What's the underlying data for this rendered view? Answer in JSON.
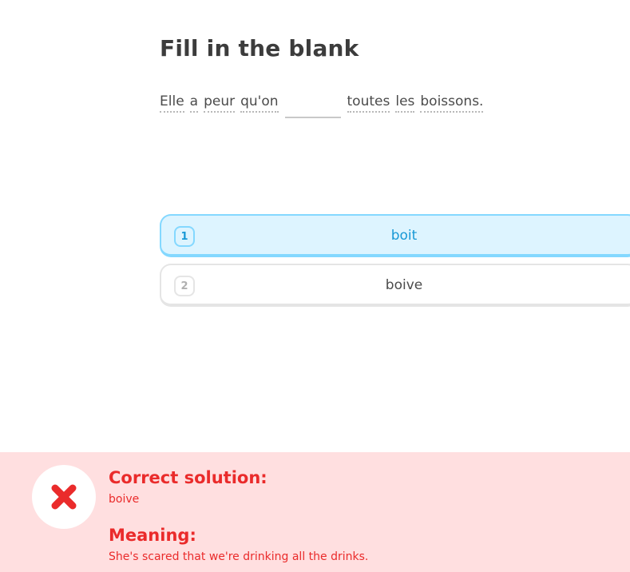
{
  "challenge": {
    "title": "Fill in the blank",
    "sentence_before": [
      "Elle",
      "a",
      "peur",
      "qu'on"
    ],
    "sentence_after": [
      "toutes",
      "les",
      "boissons."
    ]
  },
  "options": [
    {
      "number": "1",
      "text": "boit",
      "selected": true
    },
    {
      "number": "2",
      "text": "boive",
      "selected": false
    }
  ],
  "feedback": {
    "status": "incorrect",
    "status_icon": "x-icon",
    "solution_label": "Correct solution:",
    "solution": "boive",
    "meaning_label": "Meaning:",
    "meaning": "She's scared that we're drinking all the drinks."
  },
  "colors": {
    "selected_bg": "#ddf4ff",
    "selected_border": "#84d8ff",
    "selected_text": "#1899d6",
    "error_bg": "#ffdfe0",
    "error_text": "#ea2b2b"
  }
}
